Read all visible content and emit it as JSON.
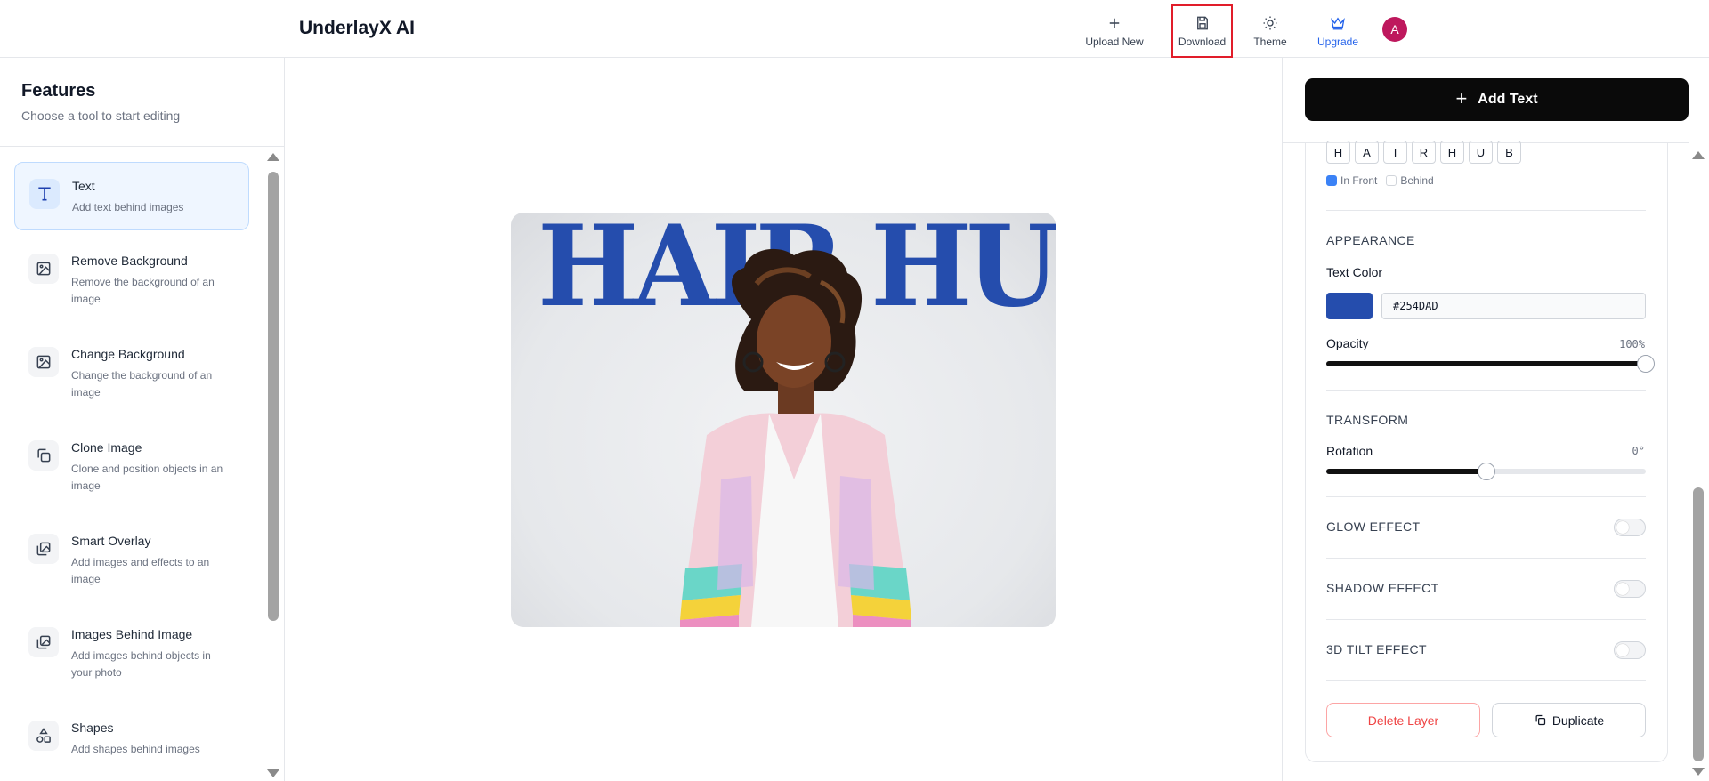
{
  "app": {
    "title": "UnderlayX AI"
  },
  "header": {
    "upload_label": "Upload New",
    "download_label": "Download",
    "theme_label": "Theme",
    "upgrade_label": "Upgrade",
    "avatar_initial": "A"
  },
  "sidebar": {
    "title": "Features",
    "subtitle": "Choose a tool to start editing",
    "items": [
      {
        "label": "Text",
        "desc": "Add text behind images",
        "icon": "text-icon"
      },
      {
        "label": "Remove Background",
        "desc": "Remove the background of an image",
        "icon": "image-icon"
      },
      {
        "label": "Change Background",
        "desc": "Change the background of an image",
        "icon": "image-icon"
      },
      {
        "label": "Clone Image",
        "desc": "Clone and position objects in an image",
        "icon": "copy-icon"
      },
      {
        "label": "Smart Overlay",
        "desc": "Add images and effects to an image",
        "icon": "images-icon"
      },
      {
        "label": "Images Behind Image",
        "desc": "Add images behind objects in your photo",
        "icon": "images-icon"
      },
      {
        "label": "Shapes",
        "desc": "Add shapes behind images",
        "icon": "shapes-icon"
      }
    ]
  },
  "canvas": {
    "overlay_text": "HAIR HUB",
    "text_color": "#254DAD"
  },
  "panel": {
    "add_text_label": "Add Text",
    "letters": [
      "H",
      "A",
      "I",
      "R",
      "H",
      "U",
      "B"
    ],
    "in_front_label": "In Front",
    "behind_label": "Behind",
    "appearance_title": "APPEARANCE",
    "text_color_label": "Text Color",
    "text_color_value": "#254DAD",
    "opacity_label": "Opacity",
    "opacity_value": "100%",
    "opacity_level": 1.0,
    "transform_title": "TRANSFORM",
    "rotation_label": "Rotation",
    "rotation_value": "0°",
    "rotation_level": 0.5,
    "glow_label": "GLOW EFFECT",
    "shadow_label": "SHADOW EFFECT",
    "tilt_label": "3D TILT EFFECT",
    "delete_label": "Delete Layer",
    "duplicate_label": "Duplicate"
  },
  "colors": {
    "accent": "#2563eb",
    "highlight": "#e11d2a",
    "avatar": "#be185d"
  }
}
